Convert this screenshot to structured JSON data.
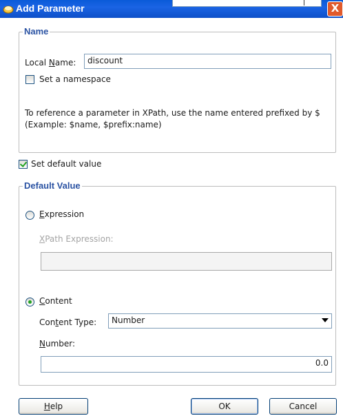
{
  "window": {
    "title": "Add Parameter",
    "close_glyph": "X"
  },
  "name_group": {
    "legend": "Name",
    "local_name_prefix": "Local ",
    "local_name_mnemonic": "N",
    "local_name_suffix": "ame:",
    "local_name_value": "discount",
    "namespace_label": "Set a namespace",
    "namespace_checked": false,
    "help_line1": "To reference a parameter in XPath, use the name entered prefixed by $",
    "help_line2": "(Example: $name, $prefix:name)"
  },
  "set_default": {
    "label": "Set default value",
    "checked": true
  },
  "default_group": {
    "legend": "Default Value",
    "expression_mnemonic": "E",
    "expression_rest": "xpression",
    "expression_selected": false,
    "xpath_mnemonic": "X",
    "xpath_rest": "Path Expression:",
    "xpath_value": "",
    "content_mnemonic": "C",
    "content_rest": "ontent",
    "content_selected": true,
    "content_type_prefix": "Con",
    "content_type_mnemonic": "t",
    "content_type_suffix": "ent Type:",
    "content_type_value": "Number",
    "number_mnemonic": "N",
    "number_rest": "umber:",
    "number_value": "0.0"
  },
  "buttons": {
    "help_mnemonic": "H",
    "help_rest": "elp",
    "ok": "OK",
    "cancel": "Cancel"
  },
  "icons": {
    "app": "oracle-jdev-icon",
    "close": "close-icon",
    "dropdown": "chevron-down-icon"
  },
  "colors": {
    "titlebar": "#0a5ad8",
    "legend": "#2b53a3",
    "close": "#e05a2c",
    "check": "#21a121"
  }
}
